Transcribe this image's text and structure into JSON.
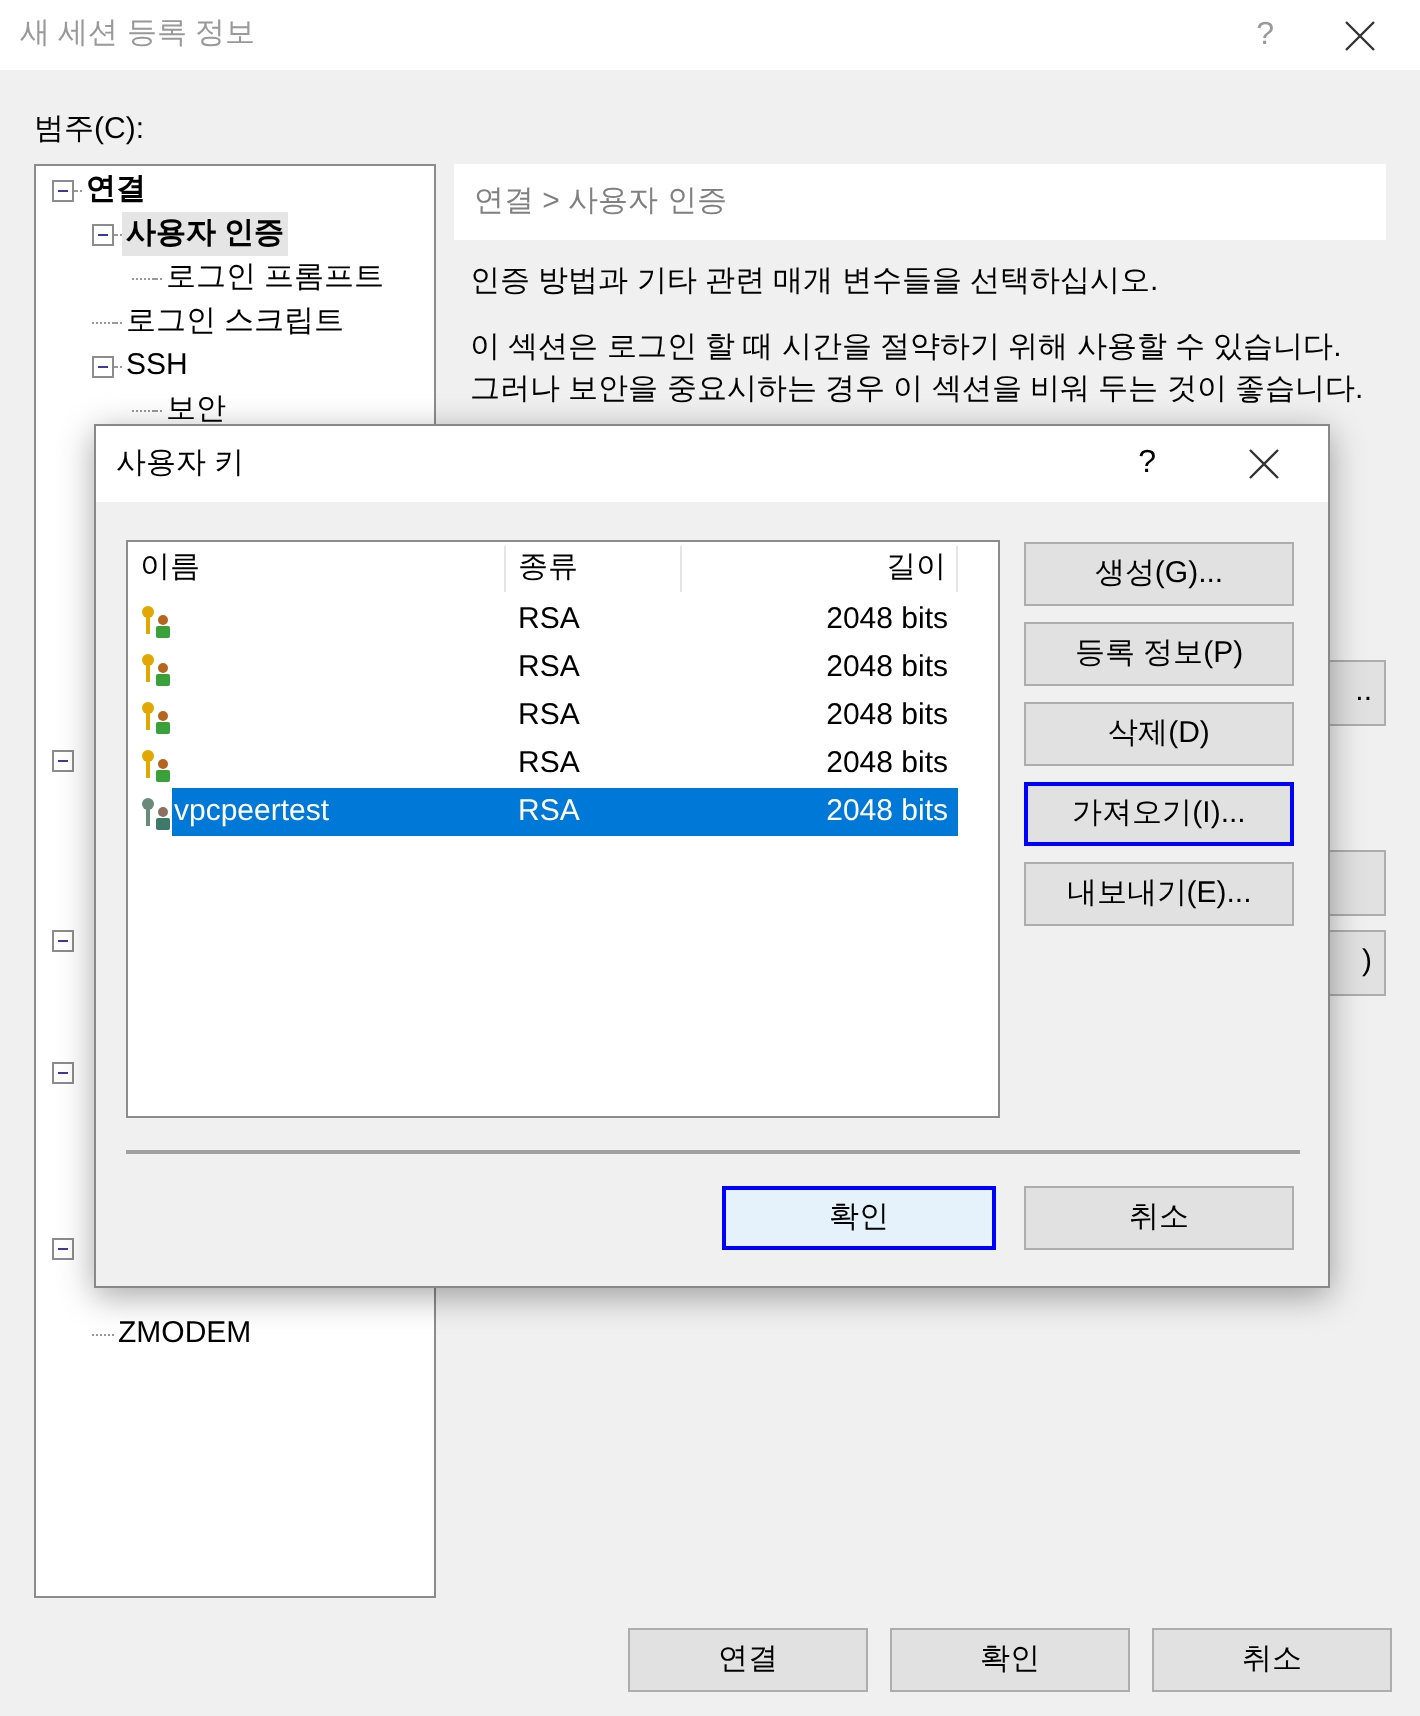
{
  "window": {
    "title": "새 세션 등록 정보",
    "help": "?"
  },
  "category_label": "범주(C):",
  "tree": [
    {
      "label": "연결",
      "bold": true,
      "selected": false,
      "children": [
        {
          "label": "사용자 인증",
          "bold": true,
          "selected": true,
          "children": [
            {
              "label": "로그인 프롬프트",
              "bold": false,
              "selected": false
            }
          ]
        },
        {
          "label": "로그인 스크립트",
          "bold": false,
          "selected": false
        },
        {
          "label": "SSH",
          "bold": false,
          "selected": false,
          "children": [
            {
              "label": "보안",
              "bold": false,
              "selected": false
            }
          ]
        }
      ]
    }
  ],
  "tree_lower": [
    {
      "label": "ZMODEM"
    }
  ],
  "breadcrumb": "연결 > 사용자 인증",
  "description": [
    "인증 방법과 기타 관련 매개 변수들을 선택하십시오.",
    "이 섹션은 로그인 할 때 시간을 절약하기 위해 사용할 수 있습니다. 그러나 보안을 중요시하는 경우 이 섹션을 비워 두는 것이 좋습니다."
  ],
  "background_button_fragments": [
    "..",
    ")"
  ],
  "buttons": [
    "연결",
    "확인",
    "취소"
  ],
  "dialog": {
    "title": "사용자 키",
    "help": "?",
    "columns": [
      "이름",
      "종류",
      "길이"
    ],
    "rows": [
      {
        "type": "RSA",
        "length": "2048 bits",
        "selected": false
      },
      {
        "type": "RSA",
        "length": "2048 bits",
        "selected": false
      },
      {
        "type": "RSA",
        "length": "2048 bits",
        "selected": false
      },
      {
        "type": "RSA",
        "length": "2048 bits",
        "selected": false
      },
      {
        "name": "vpcpeertest",
        "type": "RSA",
        "length": "2048 bits",
        "selected": true
      }
    ],
    "side_buttons": [
      {
        "label": "생성(G)...",
        "focused": false
      },
      {
        "label": "등록 정보(P)",
        "focused": false
      },
      {
        "label": "삭제(D)",
        "focused": false
      },
      {
        "label": "가져오기(I)...",
        "focused": true
      },
      {
        "label": "내보내기(E)..."
      }
    ],
    "ok": "확인",
    "cancel": "취소"
  }
}
